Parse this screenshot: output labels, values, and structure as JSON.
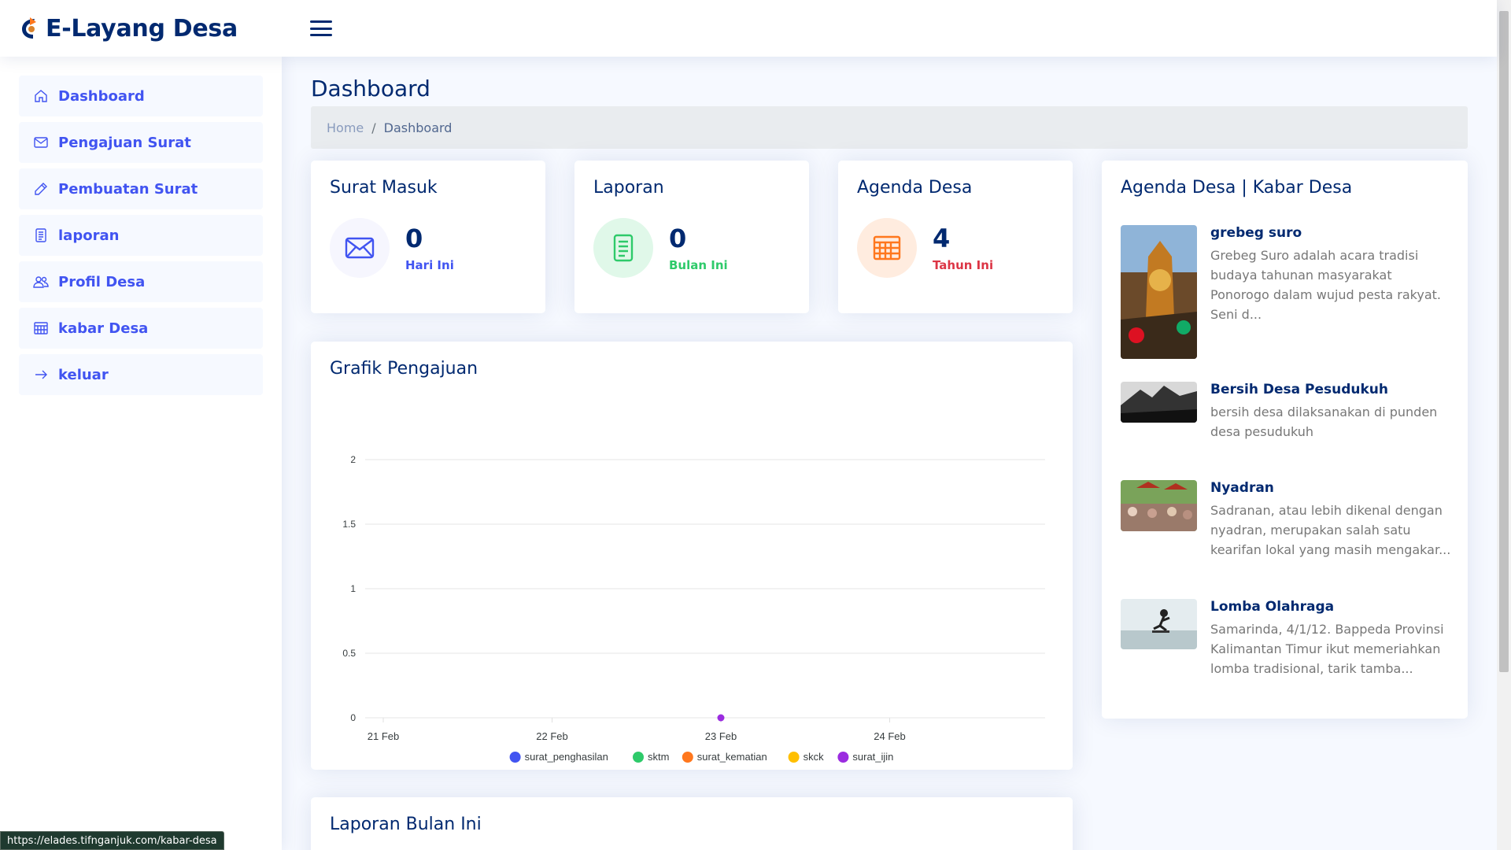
{
  "app": {
    "title": "E-Layang Desa"
  },
  "sidebar": {
    "items": [
      {
        "label": "Dashboard",
        "icon": "house-icon"
      },
      {
        "label": "Pengajuan Surat",
        "icon": "envelope-icon"
      },
      {
        "label": "Pembuatan Surat",
        "icon": "pencil-icon"
      },
      {
        "label": "laporan",
        "icon": "file-text-icon"
      },
      {
        "label": "Profil Desa",
        "icon": "people-icon"
      },
      {
        "label": "kabar Desa",
        "icon": "calendar-table-icon"
      },
      {
        "label": "keluar",
        "icon": "arrow-right-icon"
      }
    ]
  },
  "page": {
    "title": "Dashboard",
    "breadcrumb": {
      "home": "Home",
      "current": "Dashboard"
    }
  },
  "cards": {
    "surat_masuk": {
      "title": "Surat Masuk",
      "value": "0",
      "subtitle": "Hari Ini",
      "color": "#4154f1"
    },
    "laporan": {
      "title": "Laporan",
      "value": "0",
      "subtitle": "Bulan Ini",
      "color": "#2eca6a"
    },
    "agenda": {
      "title": "Agenda Desa",
      "value": "4",
      "subtitle": "Tahun Ini",
      "color": "#ff771d"
    }
  },
  "chart_section": {
    "title": "Grafik Pengajuan"
  },
  "chart_data": {
    "type": "line",
    "categories": [
      "21 Feb",
      "22 Feb",
      "23 Feb",
      "24 Feb"
    ],
    "ylim": [
      0,
      2
    ],
    "yticks": [
      "2",
      "1.5",
      "1",
      "0.5",
      "0"
    ],
    "series": [
      {
        "name": "surat_penghasilan",
        "color": "#4154f1",
        "points": []
      },
      {
        "name": "sktm",
        "color": "#2eca6a",
        "points": []
      },
      {
        "name": "surat_kematian",
        "color": "#ff771d",
        "points": []
      },
      {
        "name": "skck",
        "color": "#ffbf00",
        "points": []
      },
      {
        "name": "surat_ijin",
        "color": "#9b2ce0",
        "points": [
          {
            "x": "23 Feb",
            "y": 0
          }
        ]
      }
    ]
  },
  "news": {
    "title": "Agenda Desa | Kabar Desa",
    "items": [
      {
        "title": "grebeg suro",
        "desc": "Grebeg Suro adalah acara tradisi budaya tahunan masyarakat Ponorogo dalam wujud pesta rakyat. Seni d..."
      },
      {
        "title": "Bersih Desa Pesudukuh",
        "desc": "bersih desa dilaksanakan di punden desa pesudukuh"
      },
      {
        "title": "Nyadran",
        "desc": "Sadranan, atau lebih dikenal dengan nyadran, merupakan salah satu kearifan lokal yang masih mengakar..."
      },
      {
        "title": "Lomba Olahraga",
        "desc": "Samarinda, 4/1/12. Bappeda Provinsi Kalimantan Timur ikut memeriahkan lomba tradisional, tarik tamba..."
      }
    ]
  },
  "laporan_section": {
    "title": "Laporan Bulan Ini"
  },
  "status_bar": {
    "url": "https://elades.tifnganjuk.com/kabar-desa"
  }
}
